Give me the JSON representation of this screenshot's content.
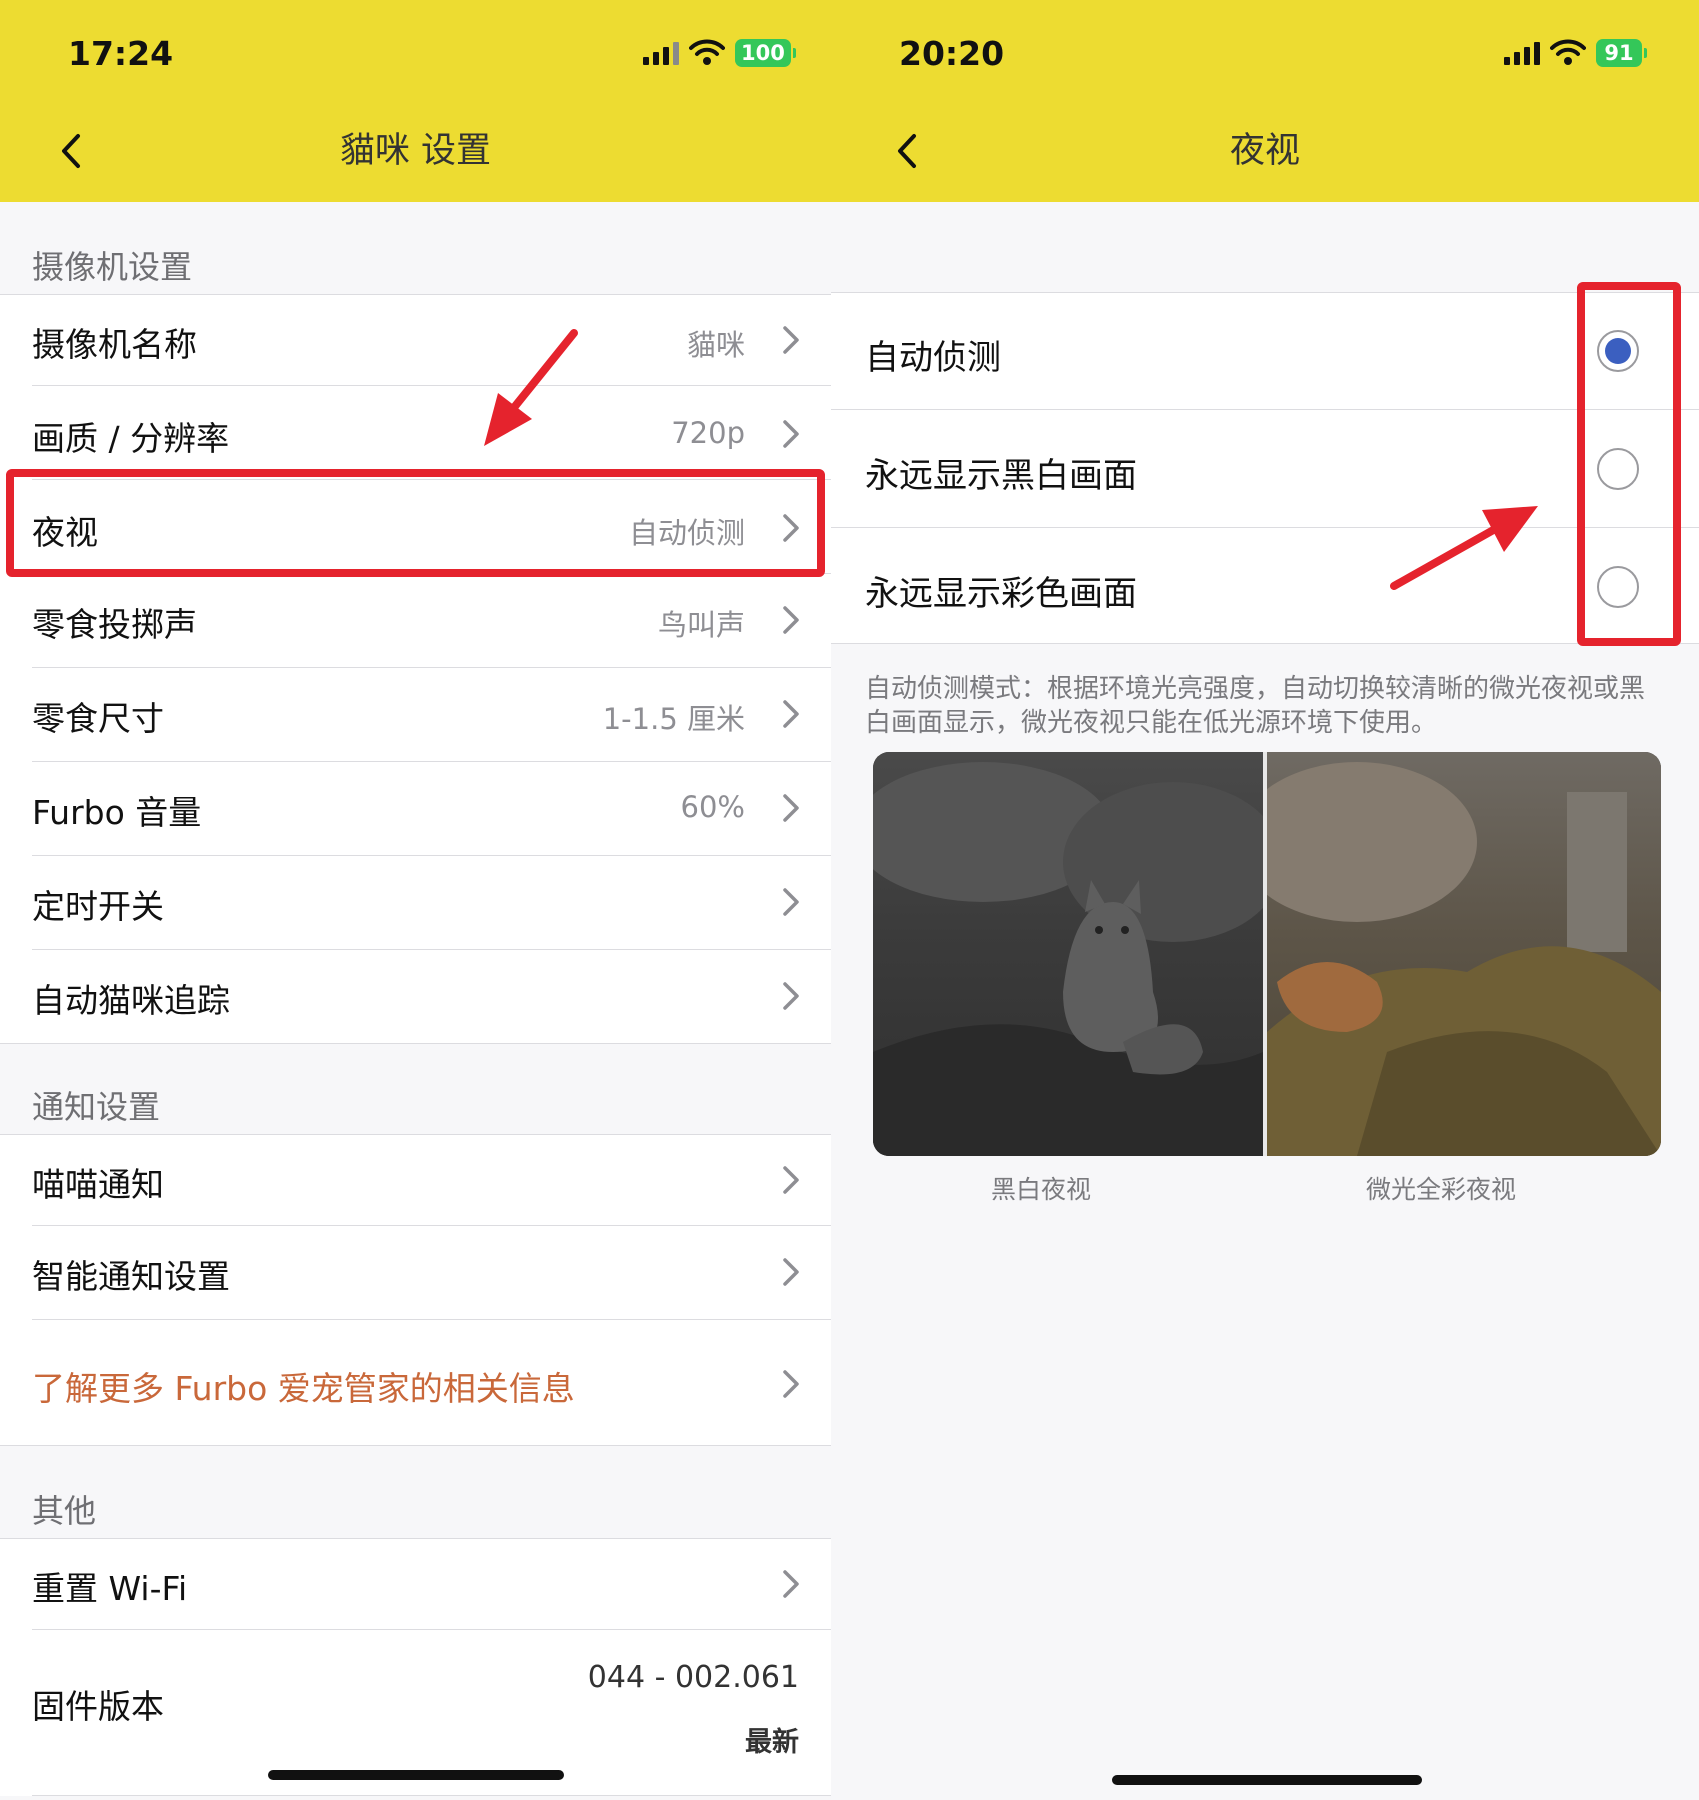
{
  "left_screen": {
    "status_bar": {
      "time": "17:24",
      "battery": "100"
    },
    "nav": {
      "title": "貓咪 设置"
    },
    "sections": {
      "camera": "摄像机设置",
      "notification": "通知设置",
      "other": "其他"
    },
    "camera_rows": [
      {
        "label": "摄像机名称",
        "value": "貓咪"
      },
      {
        "label": "画质 / 分辨率",
        "value": "720p"
      },
      {
        "label": "夜视",
        "value": "自动侦测"
      },
      {
        "label": "零食投掷声",
        "value": "鸟叫声"
      },
      {
        "label": "零食尺寸",
        "value": "1-1.5 厘米"
      },
      {
        "label": "Furbo 音量",
        "value": "60%"
      },
      {
        "label": "定时开关",
        "value": ""
      },
      {
        "label": "自动猫咪追踪",
        "value": ""
      }
    ],
    "notification_rows": [
      {
        "label": "喵喵通知"
      },
      {
        "label": "智能通知设置"
      }
    ],
    "learn_more": "了解更多 Furbo 爱宠管家的相关信息",
    "other_rows": {
      "reset_wifi": "重置 Wi-Fi",
      "firmware_label": "固件版本",
      "firmware_version": "044 - 002.061",
      "firmware_status": "最新"
    }
  },
  "right_screen": {
    "status_bar": {
      "time": "20:20",
      "battery": "91"
    },
    "nav": {
      "title": "夜视"
    },
    "options": [
      {
        "label": "自动侦测",
        "selected": true
      },
      {
        "label": "永远显示黑白画面",
        "selected": false
      },
      {
        "label": "永远显示彩色画面",
        "selected": false
      }
    ],
    "description": "自动侦测模式：根据环境光亮强度，自动切换较清晰的微光夜视或黑白画面显示，微光夜视只能在低光源环境下使用。",
    "captions": {
      "bw": "黑白夜视",
      "color": "微光全彩夜视"
    }
  },
  "icons": {
    "back": "chevron-left-icon",
    "row_arrow": "chevron-right-icon",
    "annotation": "red-arrow"
  },
  "colors": {
    "header_yellow": "#eddc31",
    "highlight_red": "#e5232d",
    "radio_selected": "#3b5fc0",
    "link_orange": "#c9683a"
  }
}
